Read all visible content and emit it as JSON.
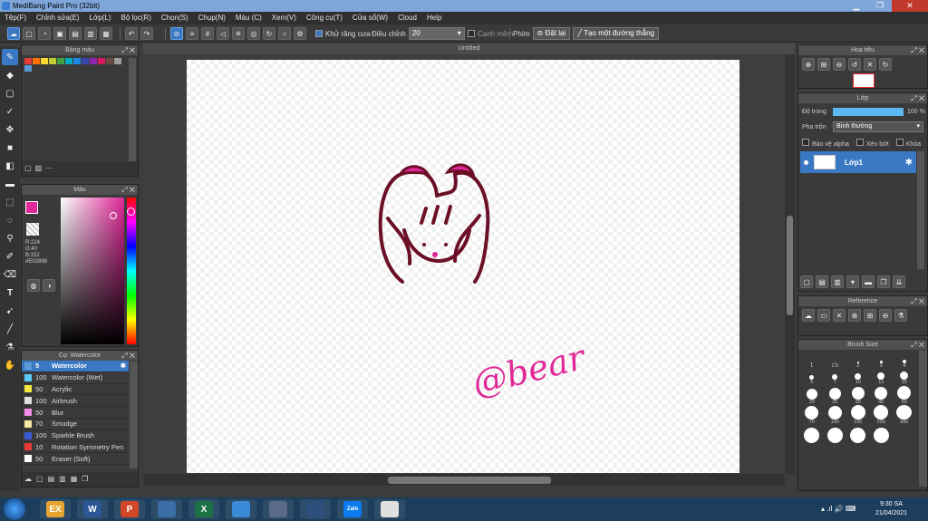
{
  "window": {
    "title": "MediBang Paint Pro (32bit)"
  },
  "menu": [
    "Tệp(F)",
    "Chỉnh sửa(E)",
    "Lớp(L)",
    "Bộ lọc(R)",
    "Chọn(S)",
    "Chụp(N)",
    "Màu (C)",
    "Xem(V)",
    "Công cụ(T)",
    "Cửa sổ(W)",
    "Cloud",
    "Help"
  ],
  "toolbar": {
    "antialias_label": "Khử răng cưa",
    "adjust_label": "Điều chỉnh",
    "adjust_value": "20",
    "snap_label": "Cạnh mềm",
    "key_label": "Phím",
    "reset_label": "Đặt lại",
    "straight_line_label": "Tạo một đường thẳng"
  },
  "canvas": {
    "title": "Untitled",
    "signature": "@bear"
  },
  "palette_panel": {
    "title": "Bảng màu",
    "swatches": [
      "#e53935",
      "#ff6f00",
      "#fdd835",
      "#c0ca33",
      "#43a047",
      "#00acc1",
      "#1e88e5",
      "#3949ab",
      "#8e24aa",
      "#d81b60",
      "#6d4c41",
      "#9e9e9e",
      "#5b9bd5"
    ]
  },
  "color_panel": {
    "title": "Màu",
    "primary": "#E02898",
    "r": "R:224",
    "g": "G:40",
    "b": "B:152",
    "hex": "#E02898"
  },
  "brush_panel": {
    "title": "Cọ: Watercolor",
    "items": [
      {
        "size": "5",
        "name": "Watercolor",
        "color": "#5b9bd5"
      },
      {
        "size": "100",
        "name": "Watercolor (Wet)",
        "color": "#5bc8f5"
      },
      {
        "size": "50",
        "name": "Acrylic",
        "color": "#f5e642"
      },
      {
        "size": "100",
        "name": "Airbrush",
        "color": "#e0e0e0"
      },
      {
        "size": "50",
        "name": "Blur",
        "color": "#f58ee8"
      },
      {
        "size": "70",
        "name": "Smudge",
        "color": "#f5e6a0"
      },
      {
        "size": "100",
        "name": "Sparkle Brush",
        "color": "#3b5bd5"
      },
      {
        "size": "10",
        "name": "Rotation Symmetry Pen",
        "color": "#e53935"
      },
      {
        "size": "50",
        "name": "Eraser (Soft)",
        "color": "#ffffff"
      }
    ]
  },
  "navigator": {
    "title": "Hoa tiêu"
  },
  "layer_panel": {
    "title": "Lớp",
    "opacity_label": "Độ trong",
    "opacity_value": "100 %",
    "blend_label": "Pha trộn",
    "blend_value": "Bình thường",
    "protect_alpha": "Bảo vệ alpha",
    "clipping": "Xén bớt",
    "lock": "Khóa",
    "layer_name": "Lớp1"
  },
  "reference_panel": {
    "title": "Reference"
  },
  "brush_size_panel": {
    "title": "Brush Size",
    "sizes": [
      "1",
      "1.5",
      "2",
      "3",
      "4",
      "5",
      "7",
      "10",
      "12",
      "15",
      "20",
      "25",
      "30",
      "40",
      "50",
      "70",
      "100",
      "150",
      "200",
      "300",
      "",
      "",
      "",
      ""
    ]
  },
  "taskbar": {
    "time": "9:30 SA",
    "date": "21/04/2021",
    "apps": [
      "EX",
      "W",
      "P",
      "",
      "X",
      "",
      "",
      "",
      "Zalo",
      ""
    ]
  }
}
